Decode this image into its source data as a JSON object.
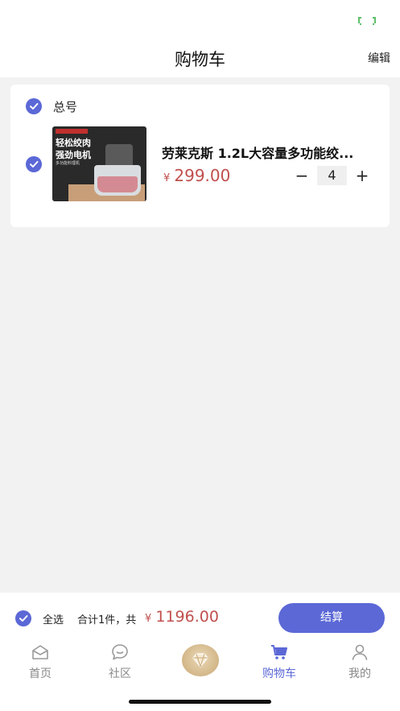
{
  "header": {
    "title": "购物车",
    "edit_label": "编辑"
  },
  "cart": {
    "shop_name": "总号",
    "items": [
      {
        "title": "劳莱克斯 1.2L大容量多功能绞...",
        "price_symbol": "¥",
        "price": "299.00",
        "quantity": "4",
        "minus_label": "−",
        "plus_label": "+",
        "image_text": {
          "line1": "轻松绞肉",
          "line2": "强劲电机",
          "line3": "多功能料理机"
        }
      }
    ]
  },
  "checkout": {
    "select_all_label": "全选",
    "summary": "合计1件，共",
    "total_symbol": "¥",
    "total": "1196.00",
    "button_label": "结算"
  },
  "tabs": [
    {
      "label": "首页",
      "icon": "home-icon"
    },
    {
      "label": "社区",
      "icon": "chat-icon"
    },
    {
      "label": "",
      "icon": "diamond-icon"
    },
    {
      "label": "购物车",
      "icon": "cart-icon"
    },
    {
      "label": "我的",
      "icon": "user-icon"
    }
  ],
  "colors": {
    "accent": "#5b68d6",
    "price": "#c0504d",
    "page_bg": "#f2f2f2",
    "center_gold": "#c9a875"
  }
}
